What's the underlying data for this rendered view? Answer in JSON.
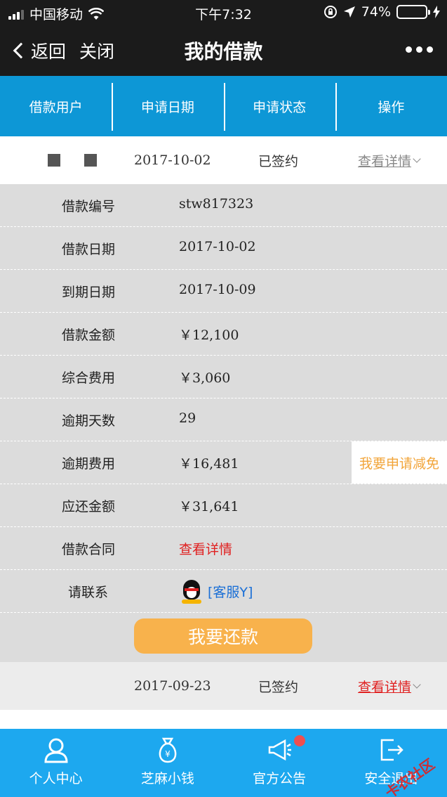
{
  "status_bar": {
    "carrier": "中国移动",
    "time": "下午7:32",
    "battery_percent": "74%",
    "battery_level": 0.74
  },
  "nav": {
    "back_label": "返回",
    "close_label": "关闭",
    "title": "我的借款"
  },
  "tabs": [
    "借款用户",
    "申请日期",
    "申请状态",
    "操作"
  ],
  "loans": [
    {
      "date": "2017-10-02",
      "status": "已签约",
      "action_label": "查看详情",
      "details": {
        "loan_no_label": "借款编号",
        "loan_no": "stw817323",
        "loan_date_label": "借款日期",
        "loan_date": "2017-10-02",
        "due_date_label": "到期日期",
        "due_date": "2017-10-09",
        "amount_label": "借款金额",
        "amount": "￥12,100",
        "fee_label": "综合费用",
        "fee": "￥3,060",
        "overdue_days_label": "逾期天数",
        "overdue_days": "29",
        "overdue_fee_label": "逾期费用",
        "overdue_fee": "￥16,481",
        "waiver_label": "我要申请减免",
        "repay_total_label": "应还金额",
        "repay_total": "￥31,641",
        "contract_label": "借款合同",
        "contract_link": "查看详情",
        "contact_label": "请联系",
        "contact_value": "[客服Y]"
      },
      "repay_button": "我要还款"
    },
    {
      "date": "2017-09-23",
      "status": "已签约",
      "action_label": "查看详情"
    }
  ],
  "bottom_nav": [
    "个人中心",
    "芝麻小钱",
    "官方公告",
    "安全退出"
  ],
  "watermark": "卡农社区",
  "colors": {
    "header": "#1b1b1b",
    "tab_bar": "#0d97d6",
    "bottom_bar": "#1da8ef",
    "repay_button": "#f8b24c",
    "link_red": "#e02020",
    "detail_bg": "#dcdcdc"
  }
}
